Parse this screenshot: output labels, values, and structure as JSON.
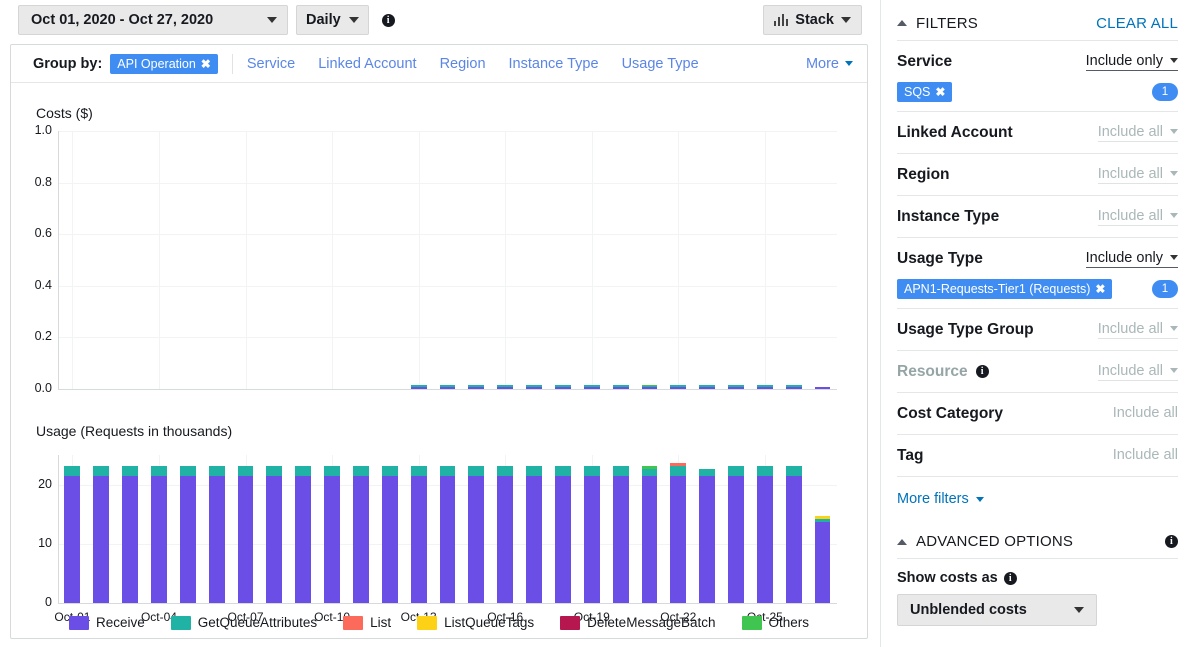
{
  "toolbar": {
    "date_range": "Oct 01, 2020 - Oct 27, 2020",
    "granularity": "Daily",
    "info_icon": "info-icon",
    "stack_label": "Stack"
  },
  "group_by": {
    "label": "Group by:",
    "selected_chip": "API Operation",
    "chip_remove": "✖",
    "links": [
      "Service",
      "Linked Account",
      "Region",
      "Instance Type",
      "Usage Type"
    ],
    "more_label": "More"
  },
  "filters": {
    "heading": "FILTERS",
    "clear_all": "CLEAR ALL",
    "rows": [
      {
        "name": "Service",
        "value": "Include only",
        "muted": false,
        "dim": false,
        "chip": "SQS",
        "count": "1"
      },
      {
        "name": "Linked Account",
        "value": "Include all",
        "muted": true,
        "dim": false
      },
      {
        "name": "Region",
        "value": "Include all",
        "muted": true,
        "dim": false
      },
      {
        "name": "Instance Type",
        "value": "Include all",
        "muted": true,
        "dim": false
      },
      {
        "name": "Usage Type",
        "value": "Include only",
        "muted": false,
        "dim": false,
        "chip": "APN1-Requests-Tier1 (Requests)",
        "count": "1"
      },
      {
        "name": "Usage Type Group",
        "value": "Include all",
        "muted": true,
        "dim": false
      },
      {
        "name": "Resource",
        "value": "Include all",
        "muted": true,
        "dim": true,
        "info": true
      },
      {
        "name": "Cost Category",
        "value": "Include all",
        "plain": true
      },
      {
        "name": "Tag",
        "value": "Include all",
        "plain": true
      }
    ],
    "more_filters": "More filters"
  },
  "advanced": {
    "heading": "ADVANCED OPTIONS",
    "show_costs_label": "Show costs as",
    "show_costs_value": "Unblended costs"
  },
  "chart_data": [
    {
      "type": "bar",
      "id": "costs",
      "title": "Costs ($)",
      "stacked": true,
      "xlabel": "",
      "ylabel": "Costs ($)",
      "ylim": [
        0,
        1.0
      ],
      "ytick_labels": [
        "0.0",
        "0.2",
        "0.4",
        "0.6",
        "0.8",
        "1.0"
      ],
      "yticks": [
        0.0,
        0.2,
        0.4,
        0.6,
        0.8,
        1.0
      ],
      "grid": true,
      "legend_position": "bottom",
      "categories": [
        "Oct-01",
        "Oct-02",
        "Oct-03",
        "Oct-04",
        "Oct-05",
        "Oct-06",
        "Oct-07",
        "Oct-08",
        "Oct-09",
        "Oct-10",
        "Oct-11",
        "Oct-12",
        "Oct-13",
        "Oct-14",
        "Oct-15",
        "Oct-16",
        "Oct-17",
        "Oct-18",
        "Oct-19",
        "Oct-20",
        "Oct-21",
        "Oct-22",
        "Oct-23",
        "Oct-24",
        "Oct-25",
        "Oct-26",
        "Oct-27"
      ],
      "xtick_labels": [
        "Oct-01",
        "Oct-04",
        "Oct-07",
        "Oct-10",
        "Oct-13",
        "Oct-16",
        "Oct-19",
        "Oct-22",
        "Oct-25"
      ],
      "series": [
        {
          "name": "Receive",
          "color": "#6b4ee6",
          "values": [
            0,
            0,
            0,
            0,
            0,
            0,
            0,
            0,
            0,
            0,
            0,
            0,
            0.009,
            0.009,
            0.009,
            0.009,
            0.009,
            0.009,
            0.009,
            0.009,
            0.009,
            0.009,
            0.009,
            0.009,
            0.009,
            0.009,
            0.006
          ]
        },
        {
          "name": "GetQueueAttributes",
          "color": "#21b2a6",
          "values": [
            0,
            0,
            0,
            0,
            0,
            0,
            0,
            0,
            0,
            0,
            0,
            0,
            0.005,
            0.005,
            0.005,
            0.005,
            0.005,
            0.005,
            0.005,
            0.005,
            0.004,
            0.005,
            0.005,
            0.005,
            0.005,
            0.005,
            0.0
          ]
        },
        {
          "name": "List",
          "color": "#fb6a5a",
          "values": [
            0,
            0,
            0,
            0,
            0,
            0,
            0,
            0,
            0,
            0,
            0,
            0,
            0,
            0,
            0,
            0,
            0,
            0,
            0,
            0,
            0,
            0.002,
            0,
            0,
            0,
            0,
            0
          ]
        },
        {
          "name": "ListQueueTags",
          "color": "#fdd116",
          "values": [
            0,
            0,
            0,
            0,
            0,
            0,
            0,
            0,
            0,
            0,
            0,
            0,
            0,
            0,
            0,
            0,
            0,
            0,
            0,
            0,
            0,
            0,
            0,
            0,
            0,
            0,
            0.003
          ]
        },
        {
          "name": "DeleteMessageBatch",
          "color": "#b5174e",
          "values": [
            0,
            0,
            0,
            0,
            0,
            0,
            0,
            0,
            0,
            0,
            0,
            0,
            0,
            0,
            0,
            0,
            0,
            0,
            0,
            0,
            0,
            0,
            0,
            0,
            0,
            0,
            0
          ]
        },
        {
          "name": "Others",
          "color": "#3fc550",
          "values": [
            0,
            0,
            0,
            0,
            0,
            0,
            0,
            0,
            0,
            0,
            0,
            0,
            0,
            0,
            0,
            0,
            0,
            0,
            0,
            0,
            0.002,
            0,
            0,
            0,
            0,
            0,
            0
          ]
        }
      ]
    },
    {
      "type": "bar",
      "id": "usage",
      "title": "Usage (Requests in thousands)",
      "stacked": true,
      "xlabel": "",
      "ylabel": "Usage (Requests in thousands)",
      "ylim": [
        0,
        25
      ],
      "ytick_labels": [
        "0",
        "10",
        "20"
      ],
      "yticks": [
        0,
        10,
        20
      ],
      "grid": true,
      "legend_position": "bottom",
      "categories": [
        "Oct-01",
        "Oct-02",
        "Oct-03",
        "Oct-04",
        "Oct-05",
        "Oct-06",
        "Oct-07",
        "Oct-08",
        "Oct-09",
        "Oct-10",
        "Oct-11",
        "Oct-12",
        "Oct-13",
        "Oct-14",
        "Oct-15",
        "Oct-16",
        "Oct-17",
        "Oct-18",
        "Oct-19",
        "Oct-20",
        "Oct-21",
        "Oct-22",
        "Oct-23",
        "Oct-24",
        "Oct-25",
        "Oct-26",
        "Oct-27"
      ],
      "xtick_labels": [
        "Oct-01",
        "Oct-04",
        "Oct-07",
        "Oct-10",
        "Oct-13",
        "Oct-16",
        "Oct-19",
        "Oct-22",
        "Oct-25"
      ],
      "series": [
        {
          "name": "Receive",
          "color": "#6b4ee6",
          "values": [
            21.5,
            21.5,
            21.5,
            21.5,
            21.5,
            21.5,
            21.5,
            21.5,
            21.5,
            21.5,
            21.5,
            21.5,
            21.5,
            21.5,
            21.5,
            21.5,
            21.5,
            21.5,
            21.5,
            21.5,
            21.4,
            21.5,
            21.4,
            21.5,
            21.5,
            21.5,
            13.7
          ]
        },
        {
          "name": "GetQueueAttributes",
          "color": "#21b2a6",
          "values": [
            1.7,
            1.7,
            1.7,
            1.7,
            1.7,
            1.7,
            1.7,
            1.7,
            1.7,
            1.7,
            1.7,
            1.7,
            1.7,
            1.7,
            1.7,
            1.7,
            1.7,
            1.7,
            1.7,
            1.7,
            1.3,
            1.7,
            1.3,
            1.7,
            1.7,
            1.7,
            0.5
          ]
        },
        {
          "name": "List",
          "color": "#fb6a5a",
          "values": [
            0,
            0,
            0,
            0,
            0,
            0,
            0,
            0,
            0,
            0,
            0,
            0,
            0,
            0,
            0,
            0,
            0,
            0,
            0,
            0,
            0,
            0.4,
            0,
            0,
            0,
            0,
            0
          ]
        },
        {
          "name": "ListQueueTags",
          "color": "#fdd116",
          "values": [
            0,
            0,
            0,
            0,
            0,
            0,
            0,
            0,
            0,
            0,
            0,
            0,
            0,
            0,
            0,
            0,
            0,
            0,
            0,
            0,
            0,
            0,
            0,
            0,
            0,
            0,
            0.5
          ]
        },
        {
          "name": "DeleteMessageBatch",
          "color": "#b5174e",
          "values": [
            0,
            0,
            0,
            0,
            0,
            0,
            0,
            0,
            0,
            0,
            0,
            0,
            0,
            0,
            0,
            0,
            0,
            0,
            0,
            0,
            0,
            0,
            0,
            0,
            0,
            0,
            0
          ]
        },
        {
          "name": "Others",
          "color": "#3fc550",
          "values": [
            0,
            0,
            0,
            0,
            0,
            0,
            0,
            0,
            0,
            0,
            0,
            0,
            0,
            0,
            0,
            0,
            0,
            0,
            0,
            0,
            0.4,
            0,
            0,
            0,
            0,
            0,
            0
          ]
        }
      ]
    }
  ],
  "legend": [
    {
      "label": "Receive",
      "color": "#6b4ee6"
    },
    {
      "label": "GetQueueAttributes",
      "color": "#21b2a6"
    },
    {
      "label": "List",
      "color": "#fb6a5a"
    },
    {
      "label": "ListQueueTags",
      "color": "#fdd116"
    },
    {
      "label": "DeleteMessageBatch",
      "color": "#b5174e"
    },
    {
      "label": "Others",
      "color": "#3fc550"
    }
  ]
}
